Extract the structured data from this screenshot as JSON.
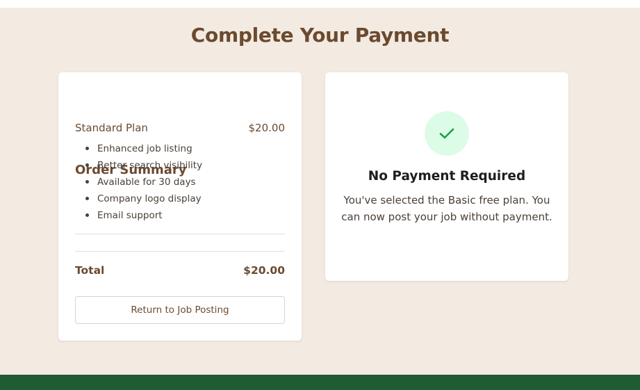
{
  "page": {
    "title": "Complete Your Payment"
  },
  "order_summary": {
    "heading": "Order Summary",
    "plan_name": "Standard Plan",
    "plan_price": "$20.00",
    "features": [
      "Enhanced job listing",
      "Better search visibility",
      "Available for 30 days",
      "Company logo display",
      "Email support"
    ],
    "total_label": "Total",
    "total_value": "$20.00",
    "return_button_label": "Return to Job Posting"
  },
  "payment_status": {
    "icon": "check-icon",
    "heading": "No Payment Required",
    "message": "You've selected the Basic free plan. You can now post your job without payment."
  },
  "colors": {
    "background": "#f3ebe1",
    "brand_brown": "#6b4a30",
    "success_green": "#16a34a",
    "success_bg": "#dcfce7",
    "footer_green": "#1f5c33"
  }
}
